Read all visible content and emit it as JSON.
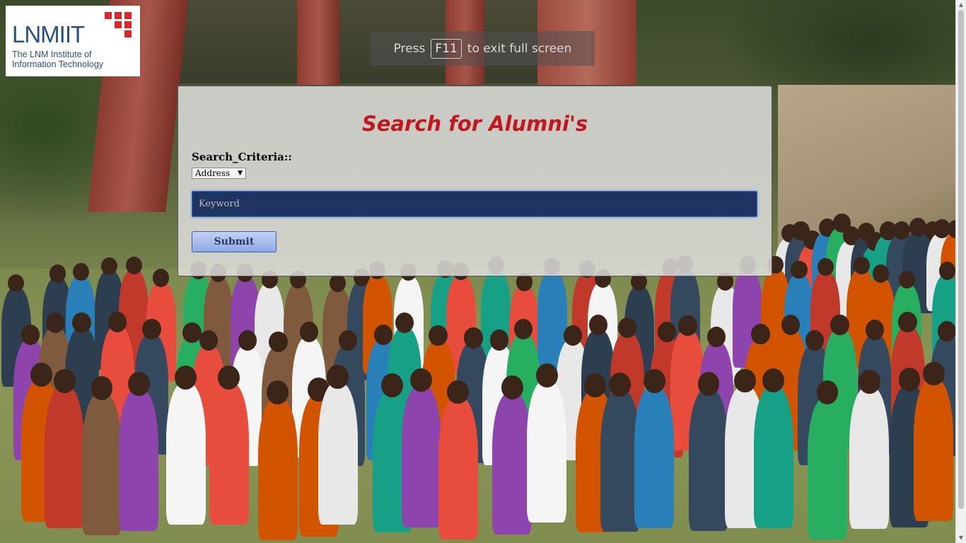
{
  "logo": {
    "name": "LNMIIT",
    "subtitle_line1": "The LNM Institute of",
    "subtitle_line2": "Information Technology",
    "accent_color": "#e1242a",
    "text_color": "#2a4e8a"
  },
  "fullscreen_notice": {
    "prefix": "Press",
    "key": "F11",
    "suffix": "to exit full screen"
  },
  "panel": {
    "title": "Search for Alumni's",
    "title_color": "#c4171d",
    "criteria_label": "Search_Criteria::",
    "criteria_selected": "Address",
    "keyword_placeholder": "Keyword",
    "keyword_value": "",
    "submit_label": "Submit"
  },
  "icons": {
    "select_arrow": "chevron-down-icon",
    "scroll_up": "scroll-up-arrow-icon",
    "scroll_down": "scroll-down-arrow-icon"
  }
}
